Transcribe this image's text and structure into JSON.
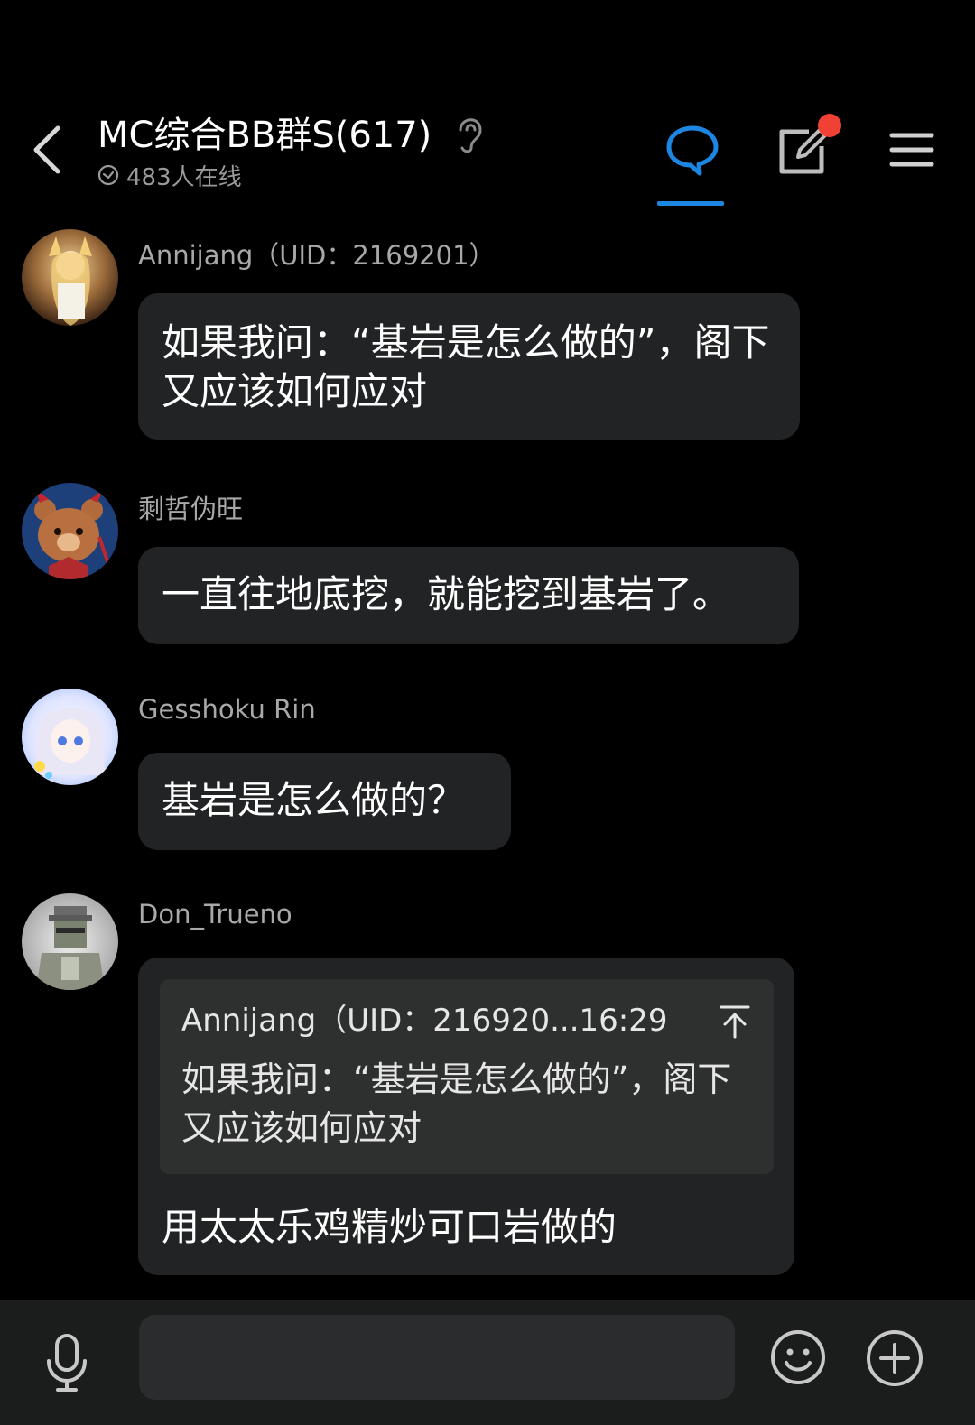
{
  "header": {
    "title": "MC综合BB群S(617)",
    "online": "483人在线",
    "icons": [
      "back-arrow-icon",
      "ear-icon",
      "check-circle-icon",
      "chat-bubble-icon",
      "edit-icon",
      "menu-icon"
    ],
    "accent_color": "#1c86e0",
    "badge_color": "#f14135"
  },
  "messages": [
    {
      "sender": "Annijang（UID：2169201）",
      "text": "如果我问：“基岩是怎么做的”，阁下又应该如何应对"
    },
    {
      "sender": "剩哲伪旺",
      "text": "一直往地底挖，就能挖到基岩了。"
    },
    {
      "sender": "Gesshoku Rin",
      "text": "基岩是怎么做的？"
    },
    {
      "sender": "Don_Trueno",
      "quote": {
        "header": "Annijang（UID：216920...16:29",
        "text": "如果我问：“基岩是怎么做的”，阁下又应该如何应对"
      },
      "text": "用太太乐鸡精炒可口岩做的"
    }
  ],
  "composer": {
    "placeholder": "",
    "icons": [
      "microphone-icon",
      "emoji-icon",
      "plus-circle-icon"
    ]
  }
}
